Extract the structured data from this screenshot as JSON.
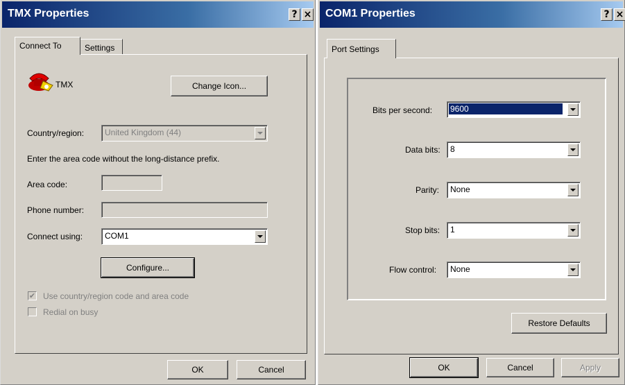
{
  "tmx": {
    "title": "TMX Properties",
    "help_btn": "?",
    "close_btn": "×",
    "tabs": [
      "Connect To",
      "Settings"
    ],
    "connection_name": "TMX",
    "change_icon_label": "Change Icon...",
    "country_label": "Country/region:",
    "country_value": "United Kingdom (44)",
    "instruction": "Enter the area code without the long-distance prefix.",
    "area_code_label": "Area code:",
    "area_code_value": "",
    "phone_label": "Phone number:",
    "phone_value": "",
    "connect_using_label": "Connect using:",
    "connect_using_value": "COM1",
    "configure_label": "Configure...",
    "use_country_label": "Use country/region code and area code",
    "use_country_checked": true,
    "redial_label": "Redial on busy",
    "redial_checked": false,
    "ok_label": "OK",
    "cancel_label": "Cancel"
  },
  "com1": {
    "title": "COM1 Properties",
    "help_btn": "?",
    "close_btn": "×",
    "tab": "Port Settings",
    "bits_label": "Bits per second:",
    "bits_value": "9600",
    "data_bits_label": "Data bits:",
    "data_bits_value": "8",
    "parity_label": "Parity:",
    "parity_value": "None",
    "stop_bits_label": "Stop bits:",
    "stop_bits_value": "1",
    "flow_label": "Flow control:",
    "flow_value": "None",
    "restore_label": "Restore Defaults",
    "ok_label": "OK",
    "cancel_label": "Cancel",
    "apply_label": "Apply"
  },
  "colors": {
    "titlebar_start": "#0a246a",
    "titlebar_end": "#a6caf0",
    "face": "#d4d0c8",
    "selection": "#0a246a"
  }
}
